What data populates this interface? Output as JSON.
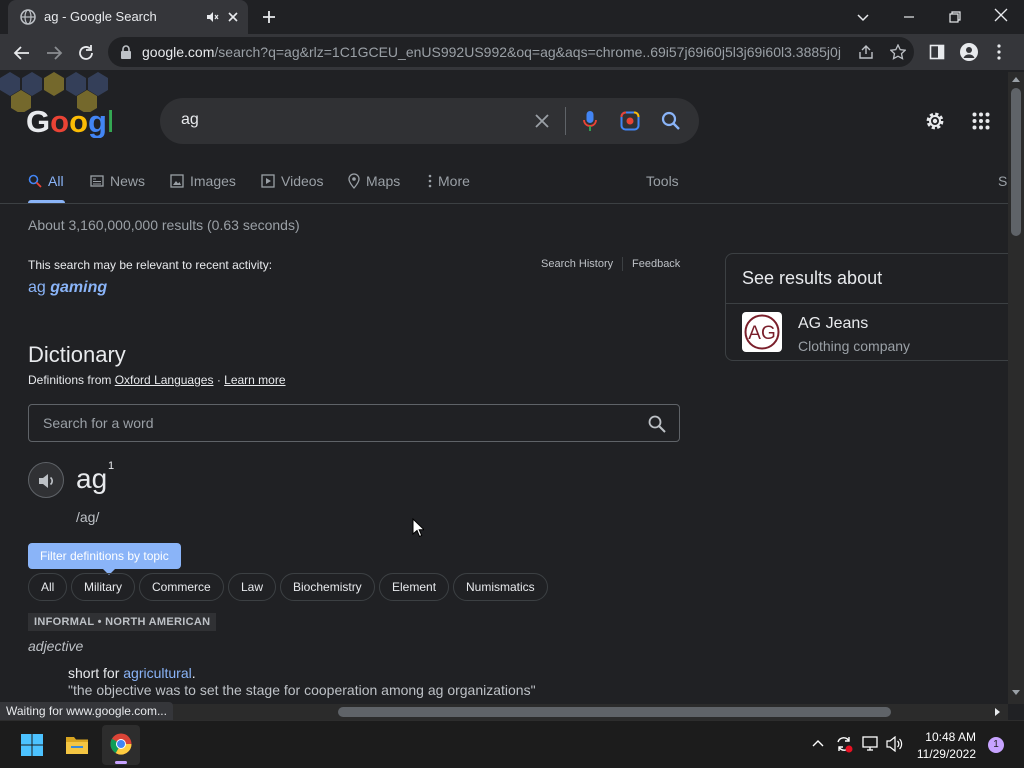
{
  "browser": {
    "tab_title": "ag - Google Search",
    "url_domain": "google.com",
    "url_rest": "/search?q=ag&rlz=1C1GCEU_enUS992US992&oq=ag&aqs=chrome..69i57j69i60j5l3j69i60l3.3885j0j..."
  },
  "search": {
    "query": "ag",
    "tabs": [
      "All",
      "News",
      "Images",
      "Videos",
      "Maps",
      "More"
    ],
    "tools": "Tools",
    "results_count": "About 3,160,000,000 results (0.63 seconds)"
  },
  "recent": {
    "notice": "This search may be relevant to recent activity:",
    "suggestion_prefix": "ag",
    "suggestion_bold": "gaming",
    "history": "Search History",
    "feedback": "Feedback"
  },
  "dictionary": {
    "heading": "Dictionary",
    "defs_from": "Definitions from",
    "source": "Oxford Languages",
    "learn_more": "Learn more",
    "search_placeholder": "Search for a word",
    "word": "ag",
    "superscript": "1",
    "phonetic": "/ag/",
    "filter_tooltip": "Filter definitions by topic",
    "topics": [
      "All",
      "Military",
      "Commerce",
      "Law",
      "Biochemistry",
      "Element",
      "Numismatics"
    ],
    "usage_label": "INFORMAL • NORTH AMERICAN",
    "pos": "adjective",
    "def_prefix": "short for",
    "def_link": "agricultural",
    "def_suffix": ".",
    "example": "\"the objective was to set the stage for cooperation among ag organizations\""
  },
  "knowledge_panel": {
    "title": "See results about",
    "entity_name": "AG Jeans",
    "entity_desc": "Clothing company",
    "logo_text": "AG"
  },
  "status": "Waiting for www.google.com...",
  "taskbar": {
    "time": "10:48 AM",
    "date": "11/29/2022",
    "notification_count": "1"
  }
}
